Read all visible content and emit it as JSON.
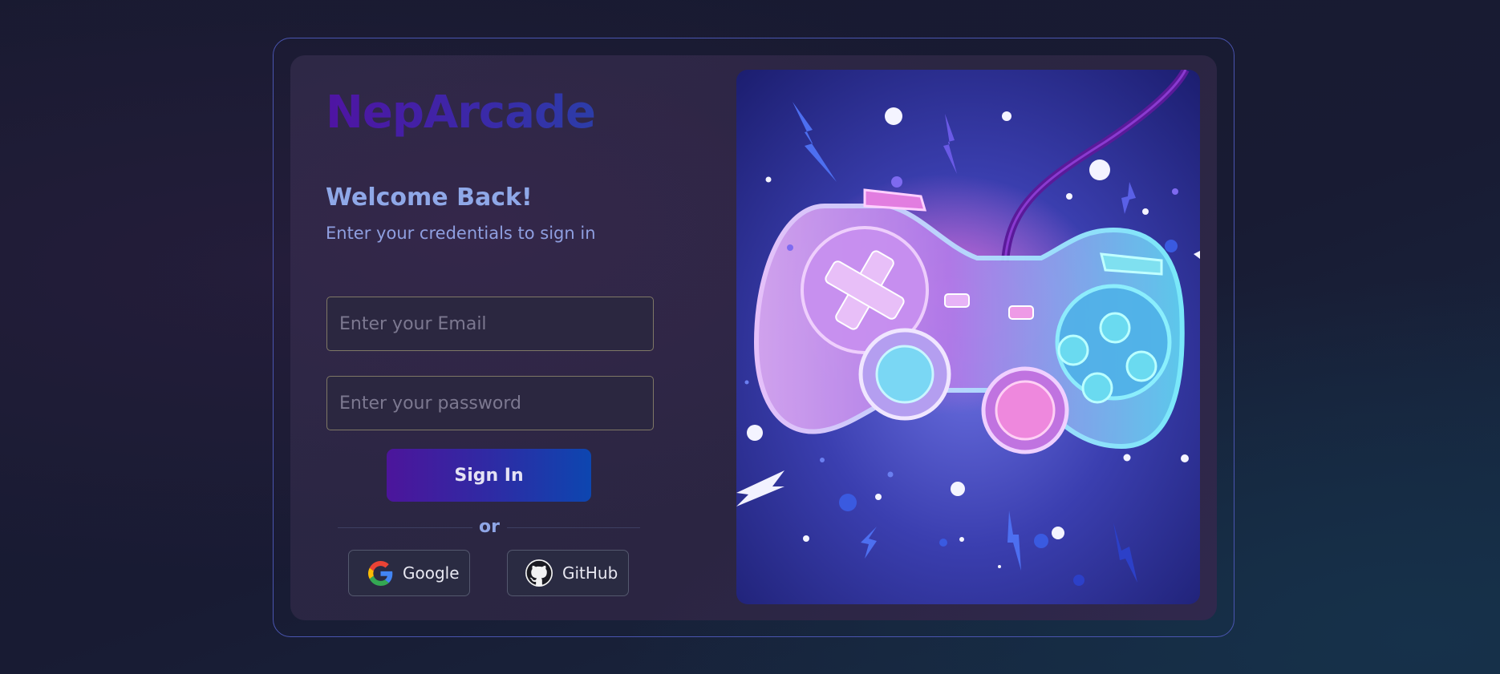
{
  "brand": {
    "name": "NepArcade"
  },
  "login": {
    "title": "Welcome Back!",
    "subtitle": "Enter your credentials to sign in",
    "email_placeholder": "Enter your Email",
    "password_placeholder": "Enter your password",
    "signin_label": "Sign In",
    "divider_text": "or"
  },
  "social": [
    {
      "label": "Google",
      "icon": "google-icon"
    },
    {
      "label": "GitHub",
      "icon": "github-icon"
    }
  ],
  "hero": {
    "image": "game-controller-illustration"
  },
  "colors": {
    "accent_start": "#4c159b",
    "accent_end": "#0d46b0",
    "frame_border": "#4a55b0",
    "text_soft": "#8fa8e8"
  }
}
